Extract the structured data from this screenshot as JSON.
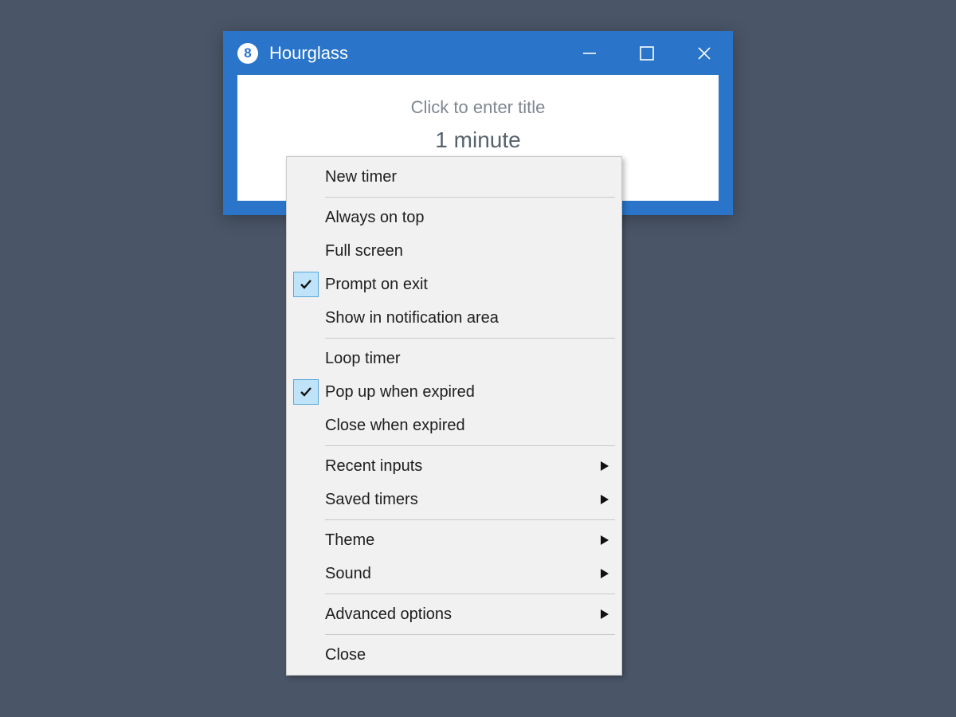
{
  "window": {
    "title": "Hourglass",
    "app_icon_text": "8"
  },
  "timer": {
    "title_placeholder": "Click to enter title",
    "value": "1 minute"
  },
  "menu": {
    "groups": [
      [
        {
          "id": "new-timer",
          "label": "New timer",
          "checked": false,
          "submenu": false
        }
      ],
      [
        {
          "id": "always-on-top",
          "label": "Always on top",
          "checked": false,
          "submenu": false
        },
        {
          "id": "full-screen",
          "label": "Full screen",
          "checked": false,
          "submenu": false
        },
        {
          "id": "prompt-on-exit",
          "label": "Prompt on exit",
          "checked": true,
          "submenu": false
        },
        {
          "id": "show-in-notification",
          "label": "Show in notification area",
          "checked": false,
          "submenu": false
        }
      ],
      [
        {
          "id": "loop-timer",
          "label": "Loop timer",
          "checked": false,
          "submenu": false
        },
        {
          "id": "pop-up-when-expired",
          "label": "Pop up when expired",
          "checked": true,
          "submenu": false
        },
        {
          "id": "close-when-expired",
          "label": "Close when expired",
          "checked": false,
          "submenu": false
        }
      ],
      [
        {
          "id": "recent-inputs",
          "label": "Recent inputs",
          "checked": false,
          "submenu": true
        },
        {
          "id": "saved-timers",
          "label": "Saved timers",
          "checked": false,
          "submenu": true
        }
      ],
      [
        {
          "id": "theme",
          "label": "Theme",
          "checked": false,
          "submenu": true
        },
        {
          "id": "sound",
          "label": "Sound",
          "checked": false,
          "submenu": true
        }
      ],
      [
        {
          "id": "advanced-options",
          "label": "Advanced options",
          "checked": false,
          "submenu": true
        }
      ],
      [
        {
          "id": "close",
          "label": "Close",
          "checked": false,
          "submenu": false
        }
      ]
    ]
  }
}
